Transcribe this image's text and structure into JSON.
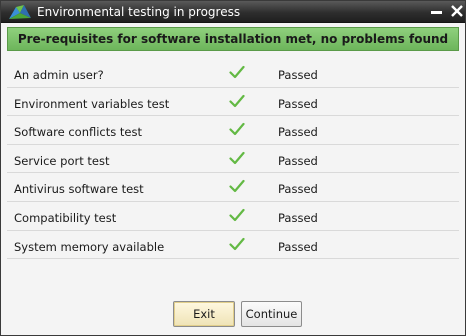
{
  "window": {
    "title": "Environmental testing in progress",
    "banner": "Pre-requisites for software installation met, no problems found"
  },
  "icons": {
    "app": "app-logo-icon",
    "minimize": "minimize-icon",
    "close": "close-icon",
    "check": "check-icon"
  },
  "colors": {
    "banner": "#7cc36a",
    "check": "#63b944",
    "titlebar": "#2e2e2e"
  },
  "checks": [
    {
      "label": "An admin user?",
      "status": "Passed"
    },
    {
      "label": "Environment variables test",
      "status": "Passed"
    },
    {
      "label": "Software conflicts test",
      "status": "Passed"
    },
    {
      "label": "Service port test",
      "status": "Passed"
    },
    {
      "label": "Antivirus software test",
      "status": "Passed"
    },
    {
      "label": "Compatibility test",
      "status": "Passed"
    },
    {
      "label": "System memory available",
      "status": "Passed"
    }
  ],
  "buttons": {
    "exit": "Exit",
    "continue": "Continue"
  }
}
